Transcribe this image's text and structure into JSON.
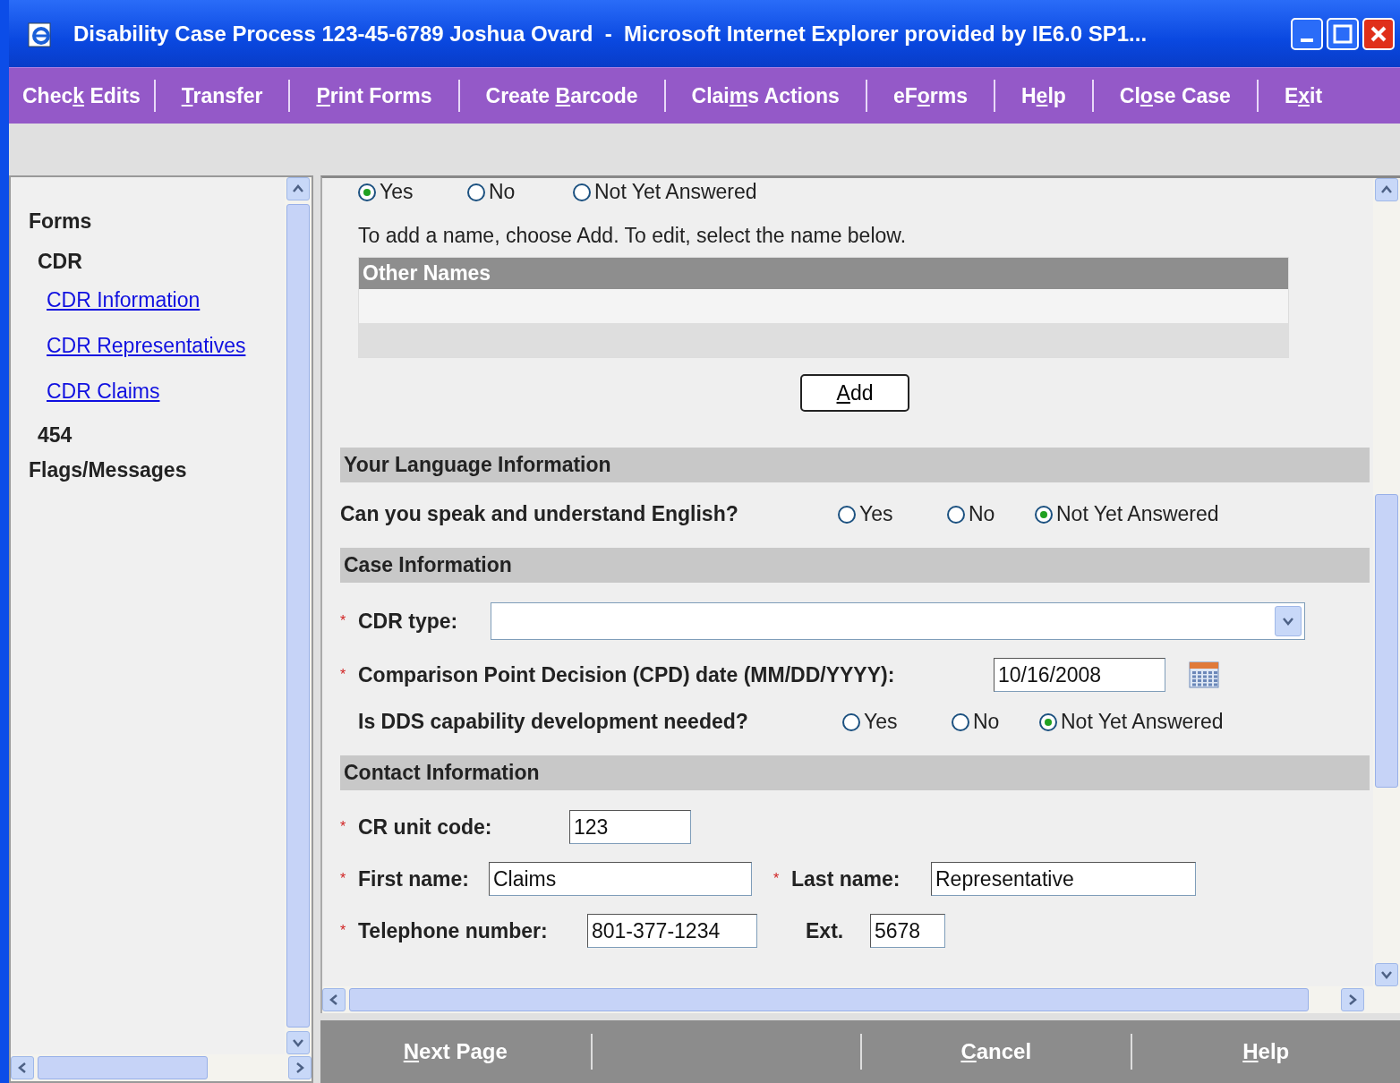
{
  "window": {
    "title": "Disability Case Process 123-45-6789 Joshua Ovard  -  Microsoft Internet Explorer provided by IE6.0 SP1..."
  },
  "menu": [
    {
      "before": "Chec",
      "key": "k",
      "after": " Edits"
    },
    {
      "key": "T",
      "after": "ransfer"
    },
    {
      "key": "P",
      "after": "rint Forms"
    },
    {
      "before": "Create ",
      "key": "B",
      "after": "arcode"
    },
    {
      "before": "Clai",
      "key": "m",
      "after": "s Actions"
    },
    {
      "before": "eF",
      "key": "o",
      "after": "rms"
    },
    {
      "before": "H",
      "key": "e",
      "after": "lp"
    },
    {
      "before": "Cl",
      "key": "o",
      "after": "se Case"
    },
    {
      "before": "E",
      "key": "x",
      "after": "it"
    }
  ],
  "sidebar": {
    "items": [
      {
        "label": "Forms",
        "children": [
          {
            "label": "CDR",
            "children": [
              {
                "label": "CDR Information",
                "kind": "link"
              },
              {
                "label": "CDR Representatives",
                "kind": "link"
              },
              {
                "label": "CDR Claims",
                "kind": "link"
              }
            ],
            "kind": "group"
          },
          {
            "label": "454",
            "kind": "group"
          }
        ],
        "kind": "heading"
      },
      {
        "label": "Flags/Messages",
        "kind": "heading"
      }
    ]
  },
  "top_radios": [
    {
      "label": "Yes",
      "selected": true
    },
    {
      "label": "No",
      "selected": false
    },
    {
      "label": "Not Yet Answered",
      "selected": false
    }
  ],
  "other_names": {
    "instruction": "To add a name, choose Add.  To edit, select the name below.",
    "header": "Other Names",
    "add_button": {
      "key": "A",
      "after": "dd"
    }
  },
  "sections": [
    {
      "title": "Your Language Information",
      "rows": [
        {
          "fields": [
            {
              "kind": "radio",
              "label": "Can you speak and understand English?",
              "options": [
                {
                  "label": "Yes",
                  "selected": false
                },
                {
                  "label": "No",
                  "selected": false
                },
                {
                  "label": "Not Yet Answered",
                  "selected": true
                }
              ]
            }
          ]
        }
      ]
    },
    {
      "title": "Case Information",
      "rows": [
        {
          "fields": [
            {
              "kind": "select",
              "marker": "*",
              "label": "CDR type:"
            }
          ]
        },
        {
          "fields": [
            {
              "kind": "date",
              "marker": "*",
              "label": "Comparison Point Decision (CPD) date (MM/DD/YYYY):",
              "value": "10/16/2008"
            }
          ]
        },
        {
          "fields": [
            {
              "kind": "radio",
              "label": "Is DDS capability development needed?",
              "options": [
                {
                  "label": "Yes",
                  "selected": false
                },
                {
                  "label": "No",
                  "selected": false
                },
                {
                  "label": "Not Yet Answered",
                  "selected": true
                }
              ]
            }
          ]
        }
      ]
    },
    {
      "title": "Contact Information",
      "rows": [
        {
          "fields": [
            {
              "kind": "text",
              "marker": "*",
              "label": "CR unit code:",
              "value": "123"
            }
          ]
        },
        {
          "fields": [
            {
              "kind": "text",
              "marker": "*",
              "label": "First name:",
              "value": "Claims"
            },
            {
              "kind": "text",
              "marker": "*",
              "label": "Last name:",
              "value": "Representative"
            }
          ]
        },
        {
          "fields": [
            {
              "kind": "text",
              "marker": "*",
              "label": "Telephone number:",
              "value": "801-377-1234"
            },
            {
              "kind": "text",
              "label": "Ext.",
              "value": "5678"
            }
          ]
        }
      ]
    }
  ],
  "buttons": [
    {
      "key": "N",
      "after": "ext Page"
    },
    {
      "key": "C",
      "after": "ancel"
    },
    {
      "key": "H",
      "after": "elp"
    }
  ]
}
